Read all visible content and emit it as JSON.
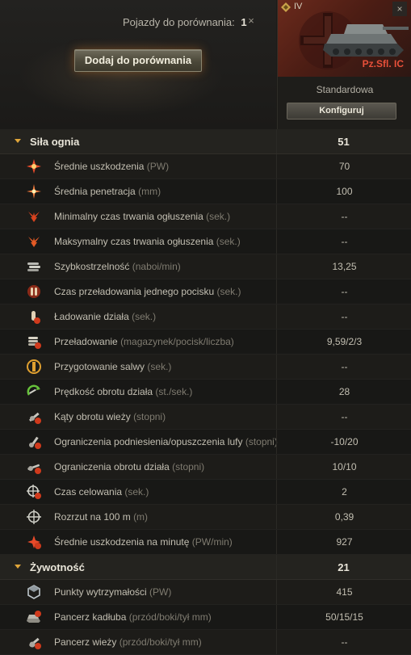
{
  "header": {
    "compare_label": "Pojazdy do porównania:",
    "compare_count": "1",
    "close_glyph": "×",
    "add_button": "Dodaj do porównania"
  },
  "vehicle": {
    "tier": "IV",
    "name": "Pz.Sfl. IC",
    "config_name": "Standardowa",
    "config_button": "Konfiguruj",
    "close_glyph": "×",
    "accent_color": "#e8503a"
  },
  "sections": [
    {
      "title": "Siła ognia",
      "value": "51",
      "stats": [
        {
          "icon": "damage-burst-icon",
          "label": "Średnie uszkodzenia",
          "unit": "(PW)",
          "value": "70"
        },
        {
          "icon": "penetration-burst-icon",
          "label": "Średnia penetracja",
          "unit": "(mm)",
          "value": "100"
        },
        {
          "icon": "stun-min-icon",
          "label": "Minimalny czas trwania ogłuszenia",
          "unit": "(sek.)",
          "value": "--"
        },
        {
          "icon": "stun-max-icon",
          "label": "Maksymalny czas trwania ogłuszenia",
          "unit": "(sek.)",
          "value": "--"
        },
        {
          "icon": "fire-rate-icon",
          "label": "Szybkostrzelność",
          "unit": "(naboi/min)",
          "value": "13,25"
        },
        {
          "icon": "shell-reload-icon",
          "label": "Czas przeładowania jednego pocisku",
          "unit": "(sek.)",
          "value": "--"
        },
        {
          "icon": "gun-loading-icon",
          "label": "Ładowanie działa",
          "unit": "(sek.)",
          "value": "--"
        },
        {
          "icon": "magazine-reload-icon",
          "label": "Przeładowanie",
          "unit": "(magazynek/pocisk/liczba)",
          "value": "9,59/2/3"
        },
        {
          "icon": "salvo-icon",
          "label": "Przygotowanie salwy",
          "unit": "(sek.)",
          "value": "--"
        },
        {
          "icon": "gun-traverse-speed-icon",
          "label": "Prędkość obrotu działa",
          "unit": "(st./sek.)",
          "value": "28"
        },
        {
          "icon": "turret-angle-icon",
          "label": "Kąty obrotu wieży",
          "unit": "(stopni)",
          "value": "--"
        },
        {
          "icon": "elevation-icon",
          "label": "Ograniczenia podniesienia/opuszczenia lufy",
          "unit": "(stopni)",
          "value": "-10/20"
        },
        {
          "icon": "gun-arc-icon",
          "label": "Ograniczenia obrotu działa",
          "unit": "(stopni)",
          "value": "10/10"
        },
        {
          "icon": "aim-time-icon",
          "label": "Czas celowania",
          "unit": "(sek.)",
          "value": "2"
        },
        {
          "icon": "dispersion-icon",
          "label": "Rozrzut na 100 m",
          "unit": "(m)",
          "value": "0,39"
        },
        {
          "icon": "dpm-icon",
          "label": "Średnie uszkodzenia na minutę",
          "unit": "(PW/min)",
          "value": "927"
        }
      ]
    },
    {
      "title": "Żywotność",
      "value": "21",
      "stats": [
        {
          "icon": "hit-points-icon",
          "label": "Punkty wytrzymałości",
          "unit": "(PW)",
          "value": "415"
        },
        {
          "icon": "hull-armor-icon",
          "label": "Pancerz kadłuba",
          "unit": "(przód/boki/tył mm)",
          "value": "50/15/15"
        },
        {
          "icon": "turret-armor-icon",
          "label": "Pancerz wieży",
          "unit": "(przód/boki/tył mm)",
          "value": "--"
        }
      ]
    }
  ]
}
